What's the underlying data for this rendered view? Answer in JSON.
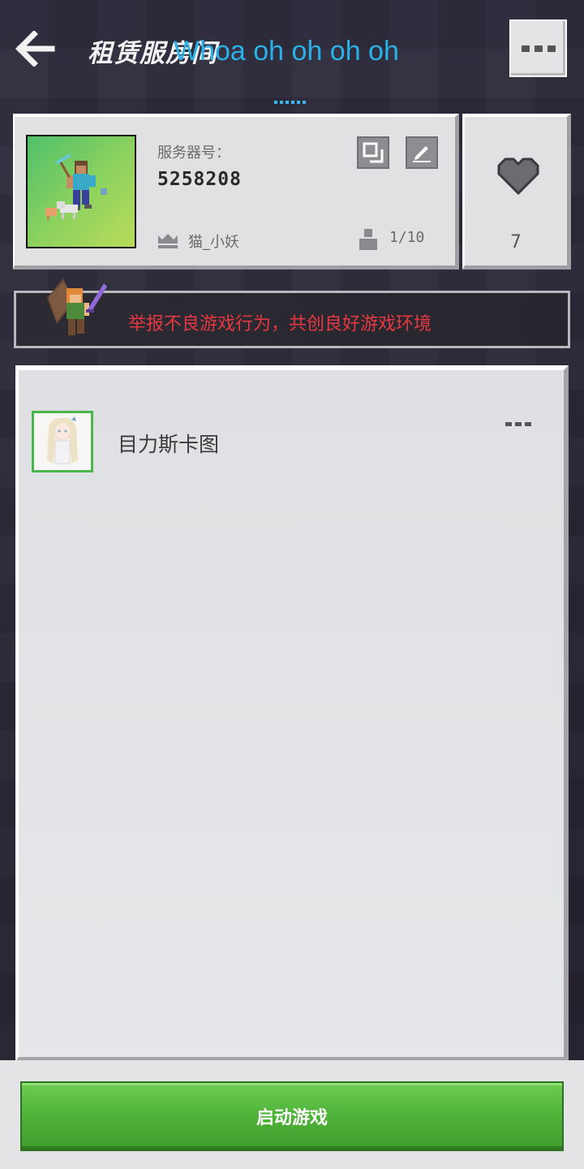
{
  "header": {
    "title": "租赁服房间",
    "overlay_lyric": "Whoa oh oh oh oh",
    "back_icon": "arrow-left-icon",
    "menu_icon": "more-dots-icon"
  },
  "server": {
    "number_label": "服务器号：",
    "number": "5258208",
    "owner": "猫_小妖",
    "players": "1/10",
    "likes": "7",
    "icons": [
      "copy-icon",
      "edit-icon",
      "crown-icon",
      "player-icon",
      "heart-icon"
    ]
  },
  "banner": {
    "text": "举报不良游戏行为，共创良好游戏环境",
    "text_color": "#e63841"
  },
  "maps": [
    {
      "name": "目力斯卡图"
    }
  ],
  "footer": {
    "start_label": "启动游戏"
  },
  "colors": {
    "accent_green": "#4fb239",
    "page_dots": "#3cb6ea",
    "lyric": "#28b2e8"
  }
}
